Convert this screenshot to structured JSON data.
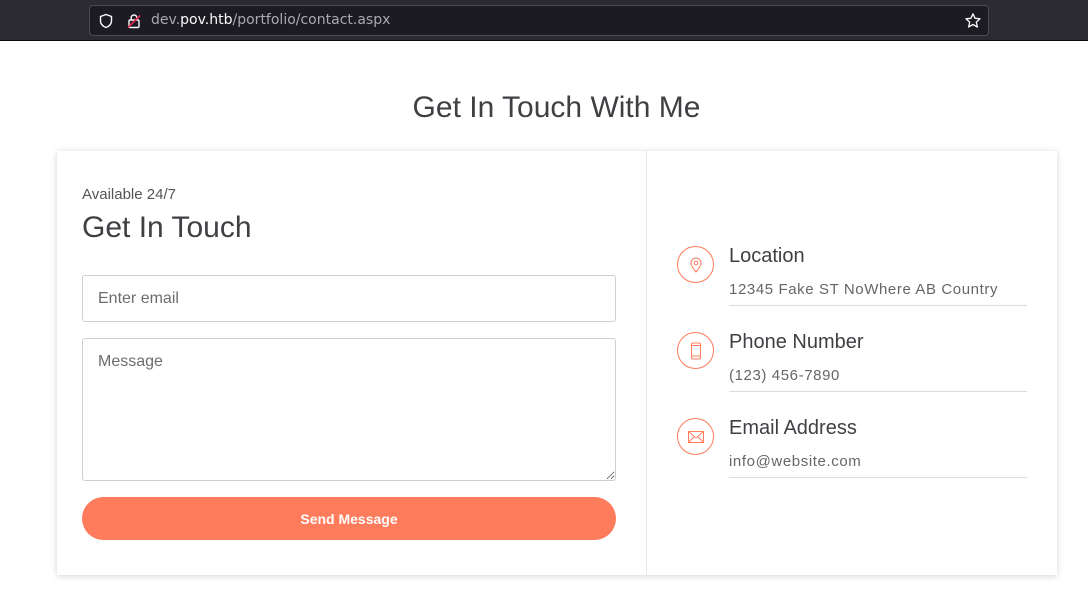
{
  "browser": {
    "url_prefix": "dev.",
    "url_host": "pov.htb",
    "url_path": "/portfolio/contact.aspx"
  },
  "page": {
    "heading": "Get In Touch With Me"
  },
  "form": {
    "availability": "Available 24/7",
    "title": "Get In Touch",
    "email_placeholder": "Enter email",
    "message_placeholder": "Message",
    "send_label": "Send Message"
  },
  "contact_info": {
    "location_label": "Location",
    "location_value": "12345 Fake ST NoWhere AB Country",
    "phone_label": "Phone Number",
    "phone_value": "(123) 456-7890",
    "email_label": "Email Address",
    "email_value": "info@website.com"
  },
  "colors": {
    "accent": "#fe7b5b",
    "heading_text": "#3f3f44",
    "browser_bar": "#2b2a33"
  },
  "icons": {
    "location": "map-pin-icon",
    "phone": "mobile-phone-icon",
    "email": "envelope-icon"
  }
}
